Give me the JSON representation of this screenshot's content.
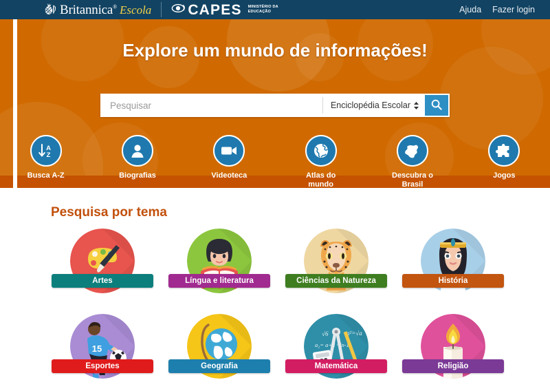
{
  "header": {
    "brand": {
      "britannica": "Britannica",
      "reg": "®",
      "escola": "Escola"
    },
    "partner": {
      "name": "CAPES",
      "ministry_line1": "MINISTÉRIO DA",
      "ministry_line2": "EDUCAÇÃO"
    },
    "nav": [
      {
        "label": "Ajuda",
        "name": "help-link"
      },
      {
        "label": "Fazer login",
        "name": "login-link"
      }
    ],
    "bg_color": "#124363"
  },
  "hero": {
    "title": "Explore um mundo de informações!",
    "bg_color": "#d06a00",
    "search": {
      "placeholder": "Pesquisar",
      "value": "",
      "scope_selected": "Enciclopédia Escolar",
      "button_icon": "search-icon",
      "button_color": "#2e8fc4"
    },
    "quicknav": [
      {
        "label": "Busca A-Z",
        "icon": "sort-az-icon"
      },
      {
        "label": "Biografias",
        "icon": "person-icon"
      },
      {
        "label": "Videoteca",
        "icon": "video-camera-icon"
      },
      {
        "label": "Atlas do mundo",
        "icon": "globe-icon"
      },
      {
        "label": "Descubra o Brasil",
        "icon": "brazil-map-icon"
      },
      {
        "label": "Jogos",
        "icon": "puzzle-piece-icon"
      }
    ]
  },
  "topics": {
    "heading": "Pesquisa por tema",
    "heading_color": "#c2500c",
    "rows": [
      [
        {
          "label": "Artes",
          "label_color": "#0c7f7d",
          "circle_color": "#e8544e",
          "art": "palette"
        },
        {
          "label": "Língua e literatura",
          "label_color": "#a02a8f",
          "circle_color": "#8cc63e",
          "art": "reader"
        },
        {
          "label": "Ciências da Natureza",
          "label_color": "#3e7d20",
          "circle_color": "#efd7a2",
          "art": "cheetah"
        },
        {
          "label": "História",
          "label_color": "#c25510",
          "circle_color": "#a8cfe8",
          "art": "cleopatra"
        }
      ],
      [
        {
          "label": "Esportes",
          "label_color": "#e01b1b",
          "circle_color": "#a98cd4",
          "art": "soccer"
        },
        {
          "label": "Geografia",
          "label_color": "#1d7fad",
          "circle_color": "#f5c518",
          "art": "globe"
        },
        {
          "label": "Matemática",
          "label_color": "#d31d62",
          "circle_color": "#2f8fa8",
          "art": "math"
        },
        {
          "label": "Religião",
          "label_color": "#7b3a96",
          "circle_color": "#e0519b",
          "art": "candle"
        }
      ]
    ]
  }
}
